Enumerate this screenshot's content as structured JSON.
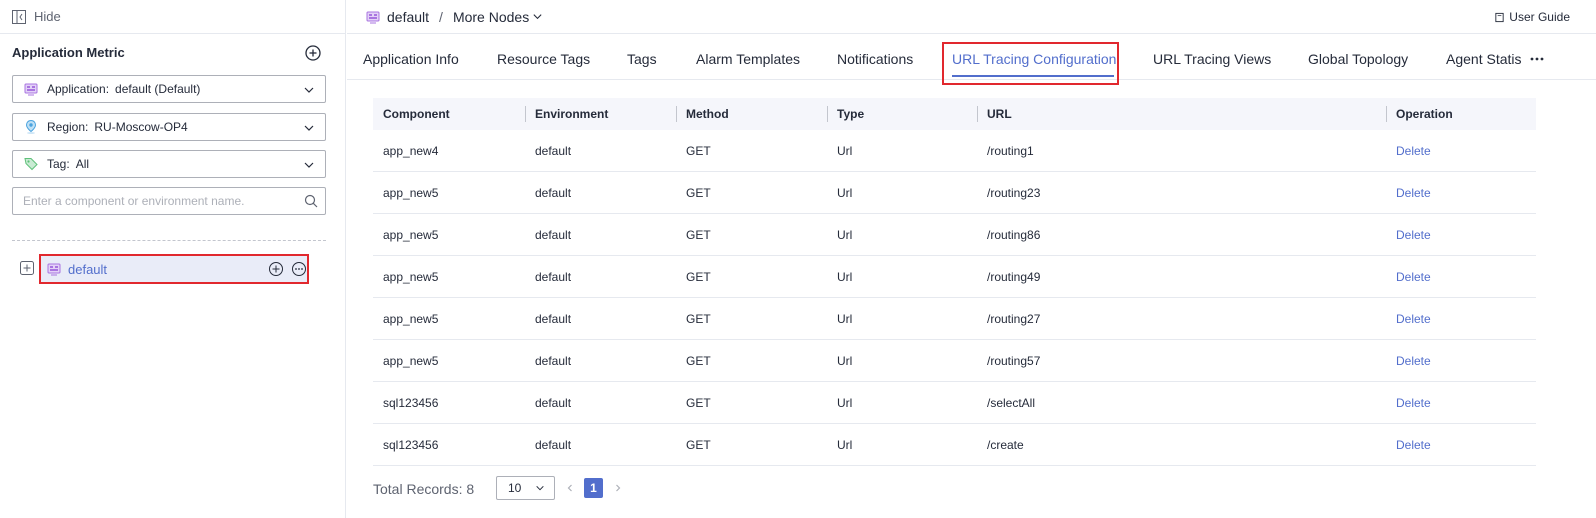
{
  "sidebar": {
    "hide_label": "Hide",
    "title": "Application Metric",
    "application": {
      "key": "Application:",
      "value": "default (Default)"
    },
    "region": {
      "key": "Region:",
      "value": "RU-Moscow-OP4"
    },
    "tag": {
      "key": "Tag:",
      "value": "All"
    },
    "search_placeholder": "Enter a component or environment name.",
    "tree": [
      {
        "label": "default"
      }
    ]
  },
  "header": {
    "breadcrumb": {
      "root": "default",
      "separator": "/",
      "current": "More Nodes"
    },
    "user_guide": "User Guide"
  },
  "tabs": [
    {
      "label": "Application Info"
    },
    {
      "label": "Resource Tags"
    },
    {
      "label": "Tags"
    },
    {
      "label": "Alarm Templates"
    },
    {
      "label": "Notifications"
    },
    {
      "label": "URL Tracing Configuration",
      "active": true
    },
    {
      "label": "URL Tracing Views"
    },
    {
      "label": "Global Topology"
    },
    {
      "label": "Agent Statis"
    }
  ],
  "table": {
    "headers": {
      "component": "Component",
      "environment": "Environment",
      "method": "Method",
      "type": "Type",
      "url": "URL",
      "operation": "Operation"
    },
    "rows": [
      {
        "component": "app_new4",
        "environment": "default",
        "method": "GET",
        "type": "Url",
        "url": "/routing1",
        "operation": "Delete"
      },
      {
        "component": "app_new5",
        "environment": "default",
        "method": "GET",
        "type": "Url",
        "url": "/routing23",
        "operation": "Delete"
      },
      {
        "component": "app_new5",
        "environment": "default",
        "method": "GET",
        "type": "Url",
        "url": "/routing86",
        "operation": "Delete"
      },
      {
        "component": "app_new5",
        "environment": "default",
        "method": "GET",
        "type": "Url",
        "url": "/routing49",
        "operation": "Delete"
      },
      {
        "component": "app_new5",
        "environment": "default",
        "method": "GET",
        "type": "Url",
        "url": "/routing27",
        "operation": "Delete"
      },
      {
        "component": "app_new5",
        "environment": "default",
        "method": "GET",
        "type": "Url",
        "url": "/routing57",
        "operation": "Delete"
      },
      {
        "component": "sql123456",
        "environment": "default",
        "method": "GET",
        "type": "Url",
        "url": "/selectAll",
        "operation": "Delete"
      },
      {
        "component": "sql123456",
        "environment": "default",
        "method": "GET",
        "type": "Url",
        "url": "/create",
        "operation": "Delete"
      }
    ]
  },
  "pagination": {
    "total_label": "Total Records: 8",
    "page_size": "10",
    "current_page": "1"
  },
  "colors": {
    "accent": "#526ecc",
    "highlight_border": "#e1282e",
    "selected_bg": "#e9ecf8",
    "app_icon": "#a974e0",
    "region_icon": "#4aa3df",
    "tag_icon": "#5fc07a"
  },
  "icons": {
    "hide": "panel-collapse-icon",
    "add": "plus-circle-icon",
    "application": "application-icon",
    "region": "location-pin-icon",
    "tag": "tag-icon",
    "search": "search-icon",
    "expand": "expand-plus-icon",
    "more": "more-circle-icon",
    "chevron": "chevron-down-icon",
    "guide": "book-icon"
  }
}
